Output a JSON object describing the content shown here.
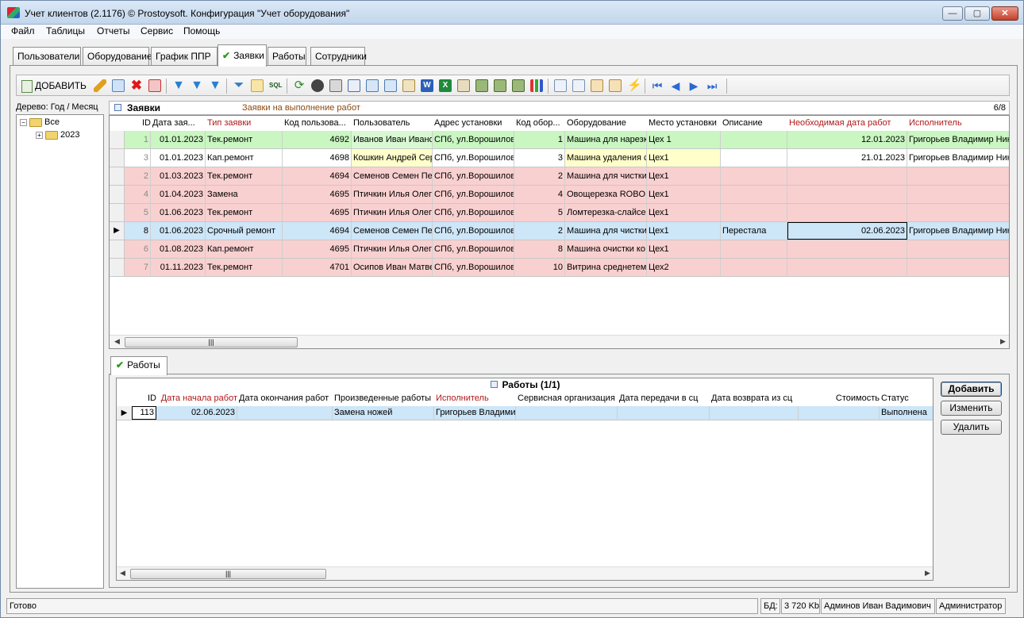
{
  "window": {
    "title": "Учет клиентов (2.1176) © Prostoysoft. Конфигурация \"Учет оборудования\""
  },
  "menu": [
    "Файл",
    "Таблицы",
    "Отчеты",
    "Сервис",
    "Помощь"
  ],
  "main_tabs": [
    "Пользователи",
    "Оборудование",
    "График ППР",
    "Заявки",
    "Работы",
    "Сотрудники"
  ],
  "toolbar": {
    "add_label": "ДОБАВИТЬ"
  },
  "tree": {
    "title": "Дерево: Год / Месяц",
    "root": "Все",
    "child": "2023"
  },
  "requests": {
    "title": "Заявки",
    "subtitle": "Заявки на выполнение работ",
    "counter": "6/8",
    "columns": [
      "ID",
      "Дата зая...",
      "Тип заявки",
      "Код пользова...",
      "Пользователь",
      "Адрес установки",
      "Код обор...",
      "Оборудование",
      "Место установки",
      "Описание",
      "Необходимая дата работ",
      "Исполнитель"
    ],
    "rows": [
      {
        "id": "1",
        "date": "01.01.2023",
        "type": "Тек.ремонт",
        "ucode": "4692",
        "user": "Иванов Иван Иванович",
        "addr": "СПб, ул.Ворошилова",
        "ecode": "1",
        "equip": "Машина для нарезки",
        "place": "Цех 1",
        "desc": "",
        "need": "12.01.2023",
        "exec": "Григорьев Владимир Николаевич"
      },
      {
        "id": "3",
        "date": "01.01.2023",
        "type": "Кап.ремонт",
        "ucode": "4698",
        "user": "Кошкин Андрей Сергеевич",
        "addr": "СПб, ул.Ворошилова",
        "ecode": "3",
        "equip": "Машина удаления с",
        "place": "Цех1",
        "desc": "",
        "need": "21.01.2023",
        "exec": "Григорьев Владимир Николаевич"
      },
      {
        "id": "2",
        "date": "01.03.2023",
        "type": "Тек.ремонт",
        "ucode": "4694",
        "user": "Семенов Семен Петрович",
        "addr": "СПб, ул.Ворошилова",
        "ecode": "2",
        "equip": "Машина для чистки",
        "place": "Цех1",
        "desc": "",
        "need": "",
        "exec": ""
      },
      {
        "id": "4",
        "date": "01.04.2023",
        "type": "Замена",
        "ucode": "4695",
        "user": "Птичкин Илья Олегович",
        "addr": "СПб, ул.Ворошилова",
        "ecode": "4",
        "equip": "Овощерезка ROBO",
        "place": "Цех1",
        "desc": "",
        "need": "",
        "exec": ""
      },
      {
        "id": "5",
        "date": "01.06.2023",
        "type": "Тек.ремонт",
        "ucode": "4695",
        "user": "Птичкин Илья Олегович",
        "addr": "СПб, ул.Ворошилова",
        "ecode": "5",
        "equip": "Ломтерезка-слайсер",
        "place": "Цех1",
        "desc": "",
        "need": "",
        "exec": ""
      },
      {
        "id": "8",
        "date": "01.06.2023",
        "type": "Срочный ремонт",
        "ucode": "4694",
        "user": "Семенов Семен Петрович",
        "addr": "СПб, ул.Ворошилова",
        "ecode": "2",
        "equip": "Машина для чистки",
        "place": "Цех1",
        "desc": "Перестала",
        "need": "02.06.2023",
        "exec": "Григорьев Владимир Николаевич"
      },
      {
        "id": "6",
        "date": "01.08.2023",
        "type": "Кап.ремонт",
        "ucode": "4695",
        "user": "Птичкин Илья Олегович",
        "addr": "СПб, ул.Ворошилова",
        "ecode": "8",
        "equip": "Машина очистки ко",
        "place": "Цех1",
        "desc": "",
        "need": "",
        "exec": ""
      },
      {
        "id": "7",
        "date": "01.11.2023",
        "type": "Тек.ремонт",
        "ucode": "4701",
        "user": "Осипов Иван Матвеевич",
        "addr": "СПб, ул.Ворошилова",
        "ecode": "10",
        "equip": "Витрина среднетем",
        "place": "Цех2",
        "desc": "",
        "need": "",
        "exec": ""
      }
    ]
  },
  "sub_tab": "Работы",
  "works": {
    "title": "Работы (1/1)",
    "columns": [
      "ID",
      "Дата начала работ",
      "Дата окончания работ",
      "Произведенные работы",
      "Исполнитель",
      "Сервисная организация",
      "Дата передачи в сц",
      "Дата возврата из сц",
      "Стоимость",
      "Статус"
    ],
    "rows": [
      {
        "id": "113",
        "start": "02.06.2023",
        "end": "",
        "done": "Замена ножей",
        "exec": "Григорьев Владимир Николаевич",
        "org": "",
        "sent": "",
        "ret": "",
        "cost": "",
        "status": "Выполнена"
      }
    ],
    "buttons": {
      "add": "Добавить",
      "edit": "Изменить",
      "delete": "Удалить"
    }
  },
  "status": {
    "ready": "Готово",
    "db_label": "БД:",
    "db_size": "3 720 Kb",
    "user": "Админов Иван Вадимович",
    "role": "Администратор"
  },
  "colors": {
    "green_row": "#c9f6c1",
    "red_row": "#f9d0d0",
    "selected_row": "#cde6f8",
    "highlight_cell": "#ffffcc",
    "required_header": "#b01818"
  }
}
